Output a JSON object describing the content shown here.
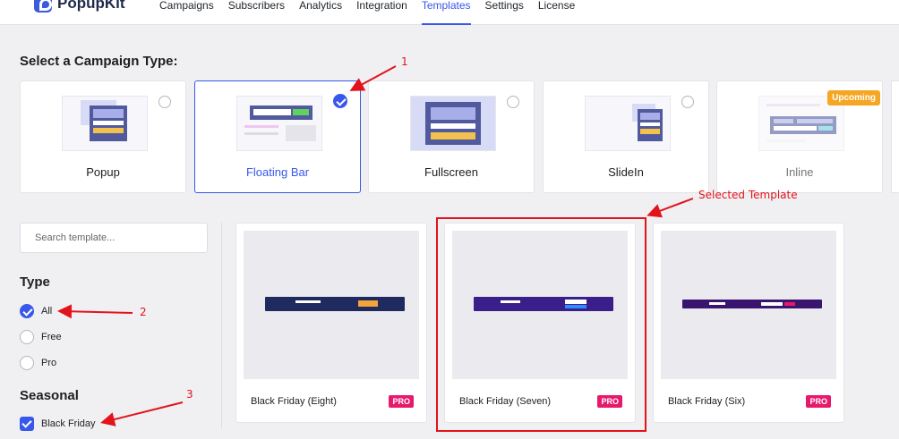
{
  "brand": {
    "name": "PopupKit"
  },
  "nav": [
    "Campaigns",
    "Subscribers",
    "Analytics",
    "Integration",
    "Templates",
    "Settings",
    "License"
  ],
  "nav_active": "Templates",
  "campaign_section": {
    "title": "Select a Campaign Type:"
  },
  "campaign_types": [
    {
      "label": "Popup",
      "selected": false
    },
    {
      "label": "Floating Bar",
      "selected": true
    },
    {
      "label": "Fullscreen",
      "selected": false
    },
    {
      "label": "SlideIn",
      "selected": false
    },
    {
      "label": "Inline",
      "selected": false,
      "badge": "Upcoming"
    }
  ],
  "search": {
    "placeholder": "Search template..."
  },
  "filters": {
    "type_title": "Type",
    "types": [
      {
        "label": "All",
        "checked": true
      },
      {
        "label": "Free",
        "checked": false
      },
      {
        "label": "Pro",
        "checked": false
      }
    ],
    "seasonal_title": "Seasonal",
    "seasonal": [
      {
        "label": "Black Friday",
        "checked": true
      }
    ]
  },
  "templates": [
    {
      "name": "Black Friday (Eight)",
      "badge": "PRO"
    },
    {
      "name": "Black Friday (Seven)",
      "badge": "PRO"
    },
    {
      "name": "Black Friday (Six)",
      "badge": "PRO"
    }
  ],
  "annotations": {
    "num1": "1",
    "num2": "2",
    "num3": "3",
    "selected_template": "Selected Template"
  },
  "colors": {
    "accent": "#3858e9",
    "pro": "#e6196d",
    "annotation": "#e3131b",
    "upcoming": "#f5a623"
  }
}
